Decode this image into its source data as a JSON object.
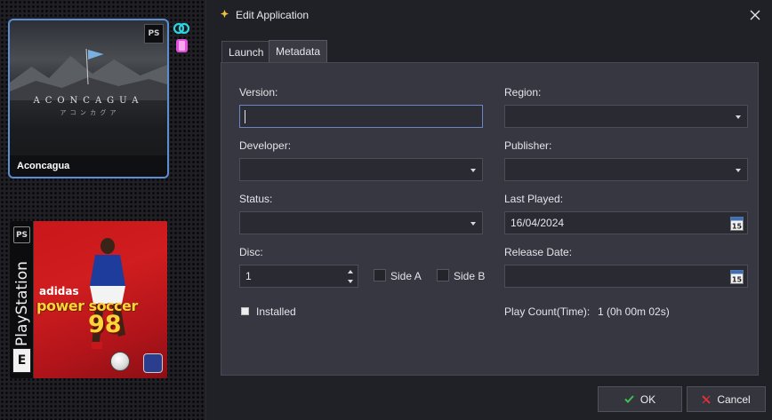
{
  "library": {
    "cards": [
      {
        "title": "Aconcagua",
        "cover_title": "ACONCAGUA",
        "cover_subtitle": "ア コ ン カ グ ア",
        "platform_mark": "PS"
      },
      {
        "spine_text": "PlayStation",
        "brand": "adidas",
        "title": "power soccer",
        "year": "98",
        "rating": "E",
        "platform_mark": "PS"
      }
    ],
    "side_icons": [
      "link-icon",
      "bookmark-icon"
    ]
  },
  "dialog": {
    "title": "Edit Application",
    "close_glyph": "✕",
    "tabs": [
      {
        "label": "Launch",
        "active": false
      },
      {
        "label": "Metadata",
        "active": true
      }
    ],
    "fields": {
      "version": {
        "label": "Version:",
        "value": ""
      },
      "region": {
        "label": "Region:",
        "value": ""
      },
      "developer": {
        "label": "Developer:",
        "value": ""
      },
      "publisher": {
        "label": "Publisher:",
        "value": ""
      },
      "status": {
        "label": "Status:",
        "value": ""
      },
      "last_played": {
        "label": "Last Played:",
        "value": "16/04/2024",
        "calendar_day": "15"
      },
      "disc": {
        "label": "Disc:",
        "value": "1"
      },
      "release_date": {
        "label": "Release Date:",
        "value": "",
        "calendar_day": "15"
      }
    },
    "side_a": {
      "label": "Side A",
      "checked": false
    },
    "side_b": {
      "label": "Side B",
      "checked": false
    },
    "installed": {
      "label": "Installed",
      "checked": false
    },
    "play_count": {
      "label": "Play Count(Time):",
      "value": "1 (0h 00m 02s)"
    },
    "buttons": {
      "ok": "OK",
      "cancel": "Cancel"
    },
    "colors": {
      "accent_focus": "#6b86c2",
      "ok_check": "#3fbf4f",
      "cancel_x": "#e0303a",
      "title_icon": "#f2c23a"
    }
  }
}
